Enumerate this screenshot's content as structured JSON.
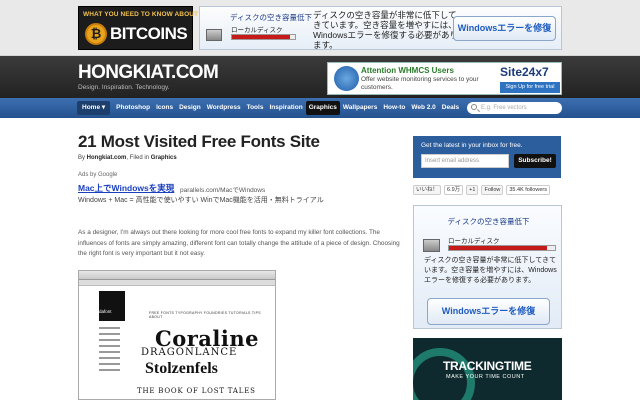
{
  "top_banner": {
    "bitcoin_ad": {
      "small": "WHAT YOU NEED TO KNOW ABOUT",
      "big": "BITCOINS"
    },
    "disk_ad": {
      "title": "ディスクの空き容量低下",
      "disk_label": "ローカルディスク",
      "disk_usage_fraction": 0.92,
      "message": "ディスクの空き容量が非常に低下してきています。空き容量を増やすには、Windowsエラーを修復する必要があります。",
      "button": "Windowsエラーを修復"
    }
  },
  "header": {
    "logo": "HONGKIAT.COM",
    "tagline": "Design. Inspiration. Technology.",
    "ad": {
      "headline": "Attention WHMCS Users",
      "desc": "Offer website monitoring services to your customers.",
      "brand": "Site24x7",
      "cta": "Sign Up for free trial"
    }
  },
  "nav": {
    "items": [
      "Home ▾",
      "Photoshop",
      "Icons",
      "Design",
      "Wordpress",
      "Tools",
      "Inspiration",
      "Graphics",
      "Wallpapers",
      "How-to",
      "Web 2.0",
      "Deals"
    ],
    "active_index": 7,
    "search_placeholder": "E.g. Free vectors"
  },
  "article": {
    "title": "21 Most Visited Free Fonts Site",
    "byline_prefix": "By ",
    "author": "Hongkiat.com",
    "filed_prefix": ", Filed in ",
    "category": "Graphics",
    "ads_by": "Ads by Google",
    "ad_link": "Mac上でWindowsを実現",
    "ad_url": "parallels.com/MacでWindows",
    "ad_desc": "Windows + Mac = 高性能で使いやすい WinでMac機能を活用・無料トライアル",
    "body": "As a designer, I'm always out there looking for more cool free fonts to expand my killer font collections. The influences of fonts are simply amazing, different font can totally change the attitude of a piece of design. Choosing the right font is very important but it not easy.",
    "screenshot": {
      "site_logo": "dafont",
      "menu": "FREE FONTS   TYPOGRAPHY   FOUNDRIES   TUTORIALS   TIPS   ABOUT",
      "fonts": [
        "Coraline",
        "DRAGONLANCE",
        "Stolzenfels",
        "THE BOOK OF LOST TALES"
      ]
    }
  },
  "sidebar": {
    "subscribe": {
      "heading": "Get the latest in your inbox for free.",
      "placeholder": "Insert email address",
      "button": "Subscribe!"
    },
    "social": {
      "fb_like": "いいね！",
      "fb_count": "6.9万",
      "gplus": "+1",
      "follow": "Follow",
      "followers": "35.4K followers"
    },
    "ad": {
      "title": "ディスクの空き容量低下",
      "disk_label": "ローカルディスク",
      "disk_usage_fraction": 0.92,
      "message": "ディスクの空き容量が非常に低下してきています。空き容量を増やすには、Windowsエラーを修復する必要があります。",
      "button": "Windowsエラーを修復"
    },
    "trackingtime": {
      "name": "TRACKINGTIME",
      "slogan": "MAKE YOUR TIME COUNT"
    }
  }
}
